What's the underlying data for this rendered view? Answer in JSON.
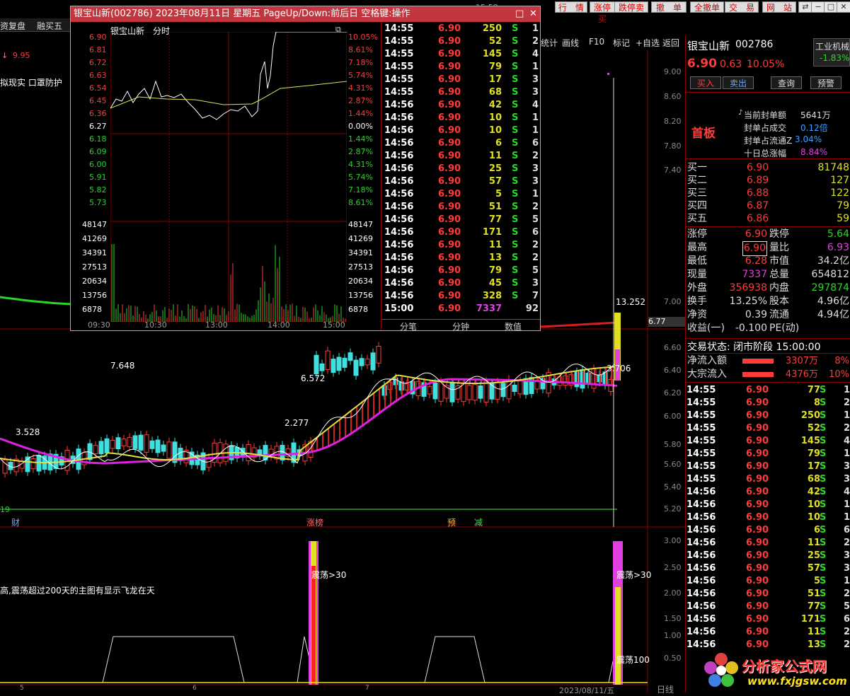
{
  "topmenu": {
    "time_partial": "15:58",
    "buttons": [
      "行　情",
      "涨停买",
      "跌停卖",
      "撤　单",
      "全撤单",
      "交　易",
      "网　站"
    ],
    "win_controls": [
      "⇄",
      "−",
      "□",
      "✕"
    ]
  },
  "left_toolbar": {
    "items": [
      "资复盘",
      "融买五"
    ]
  },
  "left_labels": {
    "price_low": "9.95",
    "strategy": "拟现实 口罩防护"
  },
  "chart_toolbar": {
    "items": [
      "统计",
      "画线",
      "F10",
      "标记",
      "+自选",
      "返回"
    ]
  },
  "popup": {
    "title": "银宝山新(002786)  2023年08月11日 星期五 PageUp/Down:前后日 空格键:操作",
    "subtitle_name": "银宝山新",
    "subtitle_mode": "分时",
    "price_labels": [
      "6.90",
      "6.81",
      "6.72",
      "6.63",
      "6.54",
      "6.45",
      "6.36",
      "6.27",
      "6.18",
      "6.09",
      "6.00",
      "5.91",
      "5.82",
      "5.73"
    ],
    "pct_labels": [
      "10.05%",
      "8.61%",
      "7.18%",
      "5.74%",
      "4.31%",
      "2.87%",
      "1.44%",
      "0.00%",
      "1.44%",
      "2.87%",
      "4.31%",
      "5.74%",
      "7.18%",
      "8.61%"
    ],
    "vol_labels": [
      "48147",
      "41269",
      "34391",
      "27513",
      "20634",
      "13756",
      "6878"
    ],
    "time_labels": [
      "09:30",
      "10:30",
      "13:00",
      "14:00",
      "15:00"
    ],
    "ticks": [
      [
        "14:55",
        "6.90",
        "250",
        "S",
        "1"
      ],
      [
        "14:55",
        "6.90",
        "52",
        "S",
        "2"
      ],
      [
        "14:55",
        "6.90",
        "145",
        "S",
        "4"
      ],
      [
        "14:55",
        "6.90",
        "79",
        "S",
        "1"
      ],
      [
        "14:55",
        "6.90",
        "17",
        "S",
        "3"
      ],
      [
        "14:55",
        "6.90",
        "68",
        "S",
        "3"
      ],
      [
        "14:56",
        "6.90",
        "42",
        "S",
        "4"
      ],
      [
        "14:56",
        "6.90",
        "10",
        "S",
        "1"
      ],
      [
        "14:56",
        "6.90",
        "10",
        "S",
        "1"
      ],
      [
        "14:56",
        "6.90",
        "6",
        "S",
        "6"
      ],
      [
        "14:56",
        "6.90",
        "11",
        "S",
        "2"
      ],
      [
        "14:56",
        "6.90",
        "25",
        "S",
        "3"
      ],
      [
        "14:56",
        "6.90",
        "57",
        "S",
        "3"
      ],
      [
        "14:56",
        "6.90",
        "5",
        "S",
        "1"
      ],
      [
        "14:56",
        "6.90",
        "51",
        "S",
        "2"
      ],
      [
        "14:56",
        "6.90",
        "77",
        "S",
        "5"
      ],
      [
        "14:56",
        "6.90",
        "171",
        "S",
        "6"
      ],
      [
        "14:56",
        "6.90",
        "11",
        "S",
        "2"
      ],
      [
        "14:56",
        "6.90",
        "13",
        "S",
        "2"
      ],
      [
        "14:56",
        "6.90",
        "79",
        "S",
        "5"
      ],
      [
        "14:56",
        "6.90",
        "45",
        "S",
        "3"
      ],
      [
        "14:56",
        "6.90",
        "328",
        "S",
        "7"
      ],
      [
        "15:00",
        "6.90",
        "7337",
        "",
        "92"
      ]
    ],
    "tabs": [
      "分笔",
      "分钟",
      "数值"
    ]
  },
  "kline": {
    "annotations": [
      "7.648",
      "3.528",
      "6.572",
      "2.277",
      "13.252",
      "3.706",
      "6.77"
    ],
    "y_labels": [
      "9.00",
      "8.60",
      "8.20",
      "7.80",
      "7.40",
      "7.00",
      "6.60",
      "6.40",
      "6.20",
      "6.00",
      "5.80",
      "5.60",
      "5.40",
      "5.20"
    ],
    "markers": [
      "财",
      "涨榜",
      "预",
      "减"
    ],
    "left_value": "19"
  },
  "indicator": {
    "text": "高,震荡超过200天的主图有显示飞龙在天",
    "labels": [
      "震荡>30",
      "震荡>30",
      "震荡100"
    ],
    "y_labels": [
      "3.00",
      "2.50",
      "2.00",
      "1.50",
      "1.00",
      "0.50"
    ],
    "date_label": "2023/08/11/五",
    "period": "日线",
    "x_labels": [
      "5",
      "6",
      "7"
    ]
  },
  "stock": {
    "name": "银宝山新",
    "code": "002786",
    "sector": "工业机械",
    "sector_change": "-1.83%",
    "price": "6.90",
    "change": "0.63",
    "change_pct": "10.05%",
    "actions": [
      "买入",
      "卖出",
      "查询",
      "预警"
    ],
    "badge": "首板",
    "seal_info": [
      {
        "label": "当前封单额",
        "value": "5641万"
      },
      {
        "label": "封单占成交",
        "value": "0.12倍"
      },
      {
        "label": "封单占流通Z",
        "value": "3.04%"
      },
      {
        "label": "十日总涨幅",
        "value": "8.84%"
      }
    ],
    "bids": [
      {
        "label": "买一",
        "price": "6.90",
        "vol": "81748"
      },
      {
        "label": "买二",
        "price": "6.89",
        "vol": "127"
      },
      {
        "label": "买三",
        "price": "6.88",
        "vol": "122"
      },
      {
        "label": "买四",
        "price": "6.87",
        "vol": "79"
      },
      {
        "label": "买五",
        "price": "6.86",
        "vol": "59"
      }
    ],
    "stats": [
      [
        "涨停",
        "6.90",
        "跌停",
        "5.64"
      ],
      [
        "最高",
        "6.90",
        "量比",
        "6.93"
      ],
      [
        "最低",
        "6.28",
        "市值",
        "34.2亿"
      ],
      [
        "现量",
        "7337",
        "总量",
        "654812"
      ],
      [
        "外盘",
        "356938",
        "内盘",
        "297874"
      ],
      [
        "换手",
        "13.25%",
        "股本",
        "4.96亿"
      ],
      [
        "净资",
        "0.39",
        "流通",
        "4.94亿"
      ],
      [
        "收益(一)",
        "-0.100",
        "PE(动)",
        ""
      ]
    ],
    "trade_status": "交易状态: 闭市阶段 15:00:00",
    "flows": [
      {
        "label": "净流入额",
        "value": "3307万",
        "pct": "8%"
      },
      {
        "label": "大宗流入",
        "value": "4376万",
        "pct": "10%"
      }
    ],
    "ticks": [
      [
        "14:55",
        "6.90",
        "77",
        "S",
        "1"
      ],
      [
        "14:55",
        "6.90",
        "8",
        "S",
        "2"
      ],
      [
        "14:55",
        "6.90",
        "250",
        "S",
        "1"
      ],
      [
        "14:55",
        "6.90",
        "52",
        "S",
        "2"
      ],
      [
        "14:55",
        "6.90",
        "145",
        "S",
        "4"
      ],
      [
        "14:55",
        "6.90",
        "79",
        "S",
        "1"
      ],
      [
        "14:55",
        "6.90",
        "17",
        "S",
        "3"
      ],
      [
        "14:55",
        "6.90",
        "68",
        "S",
        "3"
      ],
      [
        "14:56",
        "6.90",
        "42",
        "S",
        "4"
      ],
      [
        "14:56",
        "6.90",
        "10",
        "S",
        "1"
      ],
      [
        "14:56",
        "6.90",
        "10",
        "S",
        "1"
      ],
      [
        "14:56",
        "6.90",
        "6",
        "S",
        "6"
      ],
      [
        "14:56",
        "6.90",
        "11",
        "S",
        "2"
      ],
      [
        "14:56",
        "6.90",
        "25",
        "S",
        "3"
      ],
      [
        "14:56",
        "6.90",
        "57",
        "S",
        "3"
      ],
      [
        "14:56",
        "6.90",
        "5",
        "S",
        "1"
      ],
      [
        "14:56",
        "6.90",
        "51",
        "S",
        "2"
      ],
      [
        "14:56",
        "6.90",
        "77",
        "S",
        "5"
      ],
      [
        "14:56",
        "6.90",
        "171",
        "S",
        "6"
      ],
      [
        "14:56",
        "6.90",
        "11",
        "S",
        "2"
      ],
      [
        "14:56",
        "6.90",
        "13",
        "S",
        "2"
      ]
    ]
  },
  "watermark": {
    "text": "分析家公式网",
    "url": "www.fxjgsw.com"
  },
  "colors": {
    "up": "#ff3b3b",
    "down": "#28d628",
    "popup_title": "#c3363f",
    "ma_purple": "#e020e0",
    "ma_yellow": "#e0e040"
  }
}
